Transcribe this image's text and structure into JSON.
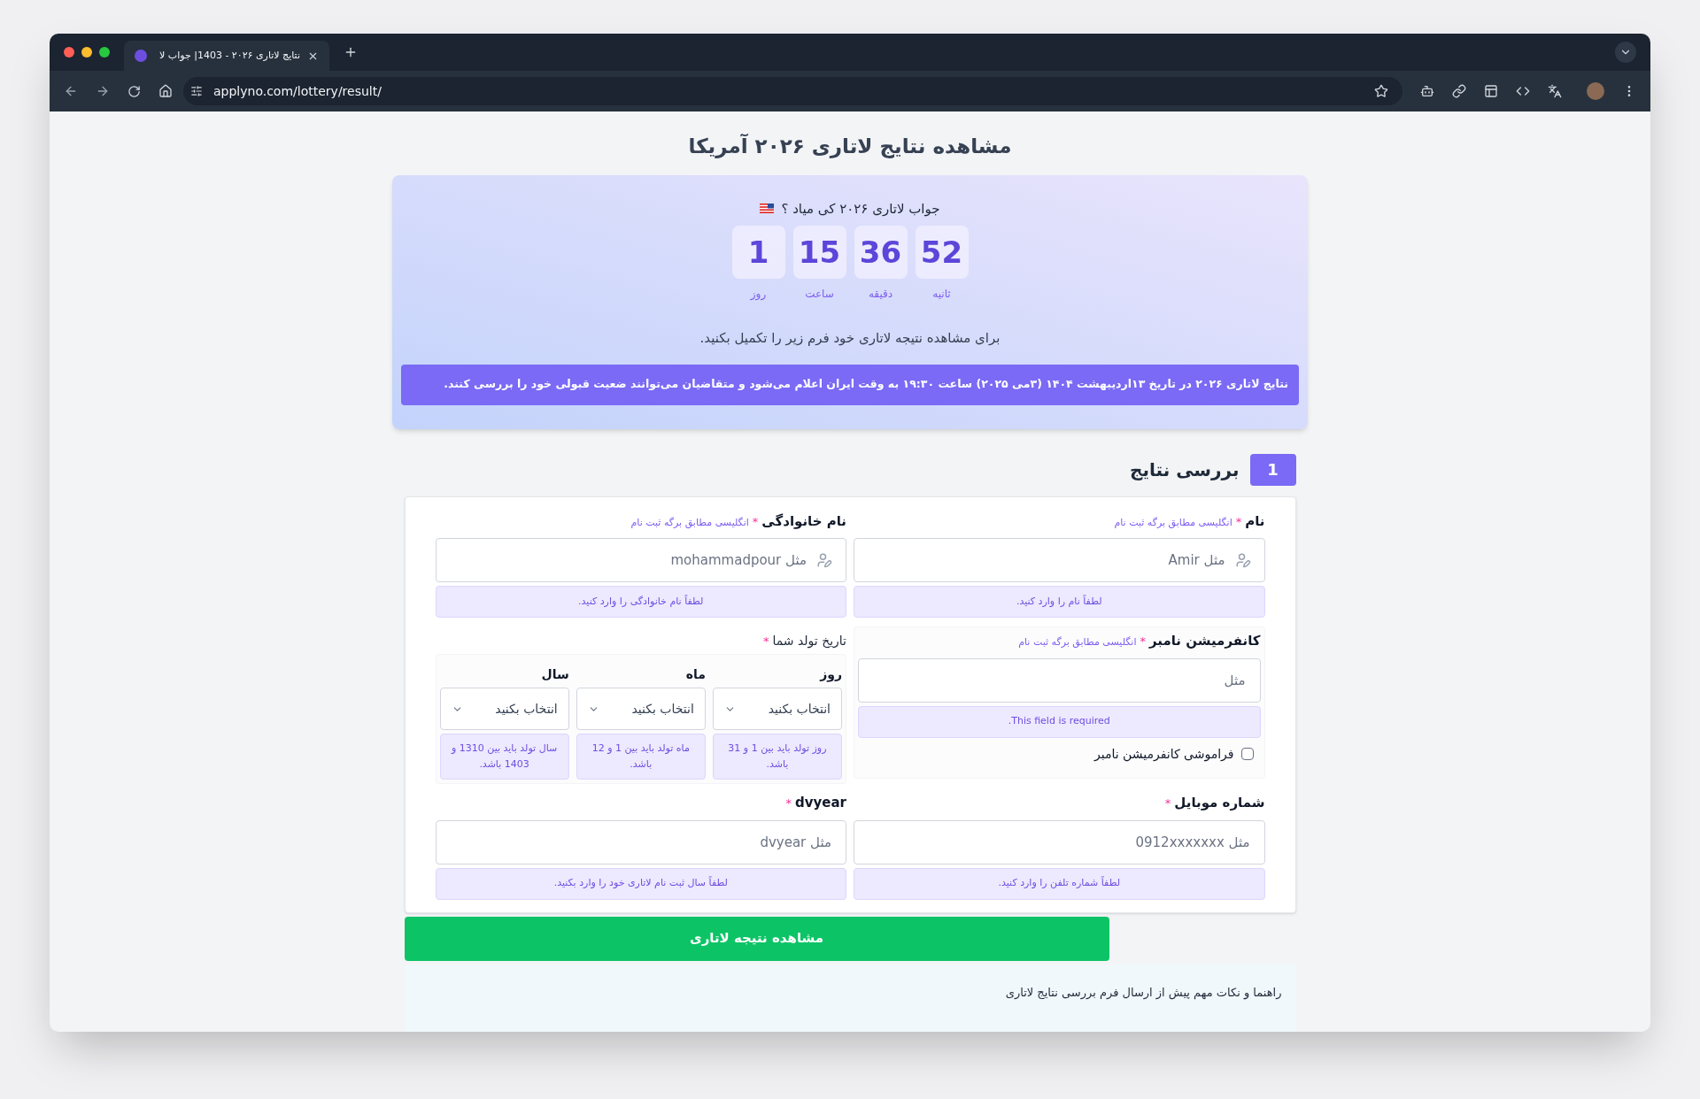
{
  "browser": {
    "tab_title": "نتایج لاتاری ۲۰۲۶ - 1403| جواب لا",
    "url": "applyno.com/lottery/result/"
  },
  "page_title": "مشاهده نتایج لاتاری ۲۰۲۶ آمریکا",
  "countdown": {
    "question": "جواب لاتاری ۲۰۲۶ کی میاد ؟",
    "units": [
      {
        "value": "52",
        "label": "ثانیه"
      },
      {
        "value": "36",
        "label": "دقیقه"
      },
      {
        "value": "15",
        "label": "ساعت"
      },
      {
        "value": "1",
        "label": "روز"
      }
    ],
    "instruction": "برای مشاهده نتیجه لاتاری خود فرم زیر را تکمیل بکنید.",
    "notice": "نتایج لاتاری ۲۰۲۶ در تاریخ ۱۳اردیبهشت ۱۴۰۴ (۳می ۲۰۲۵) ساعت ۱۹:۳۰ به وقت ایران اعلام می‌شود و متقاضیان می‌توانند ضعیت قبولی خود را بررسی کنند."
  },
  "section": {
    "number": "1",
    "title": "بررسی نتایج"
  },
  "fields": [
    {
      "kind": "person",
      "label": "نام",
      "required_mark": "*",
      "hint": "انگلیسی مطابق برگه ثبت نام",
      "placeholder": "مثل Amir",
      "error": "لطفاً نام را وارد کنید."
    },
    {
      "kind": "person",
      "label": "نام خانوادگی",
      "required_mark": "*",
      "hint": "انگلیسی مطابق برگه ثبت نام",
      "placeholder": "مثل mohammadpour",
      "error": "لطفاً نام خانوادگی را وارد کنید."
    },
    {
      "kind": "confirmation",
      "label": "کانفرمیشن نامبر",
      "required_mark": "*",
      "hint": "انگلیسی مطابق برگه ثبت نام",
      "placeholder": "مثل",
      "error": "This field is required.",
      "checkbox": {
        "label": "فراموشی کانفرمیشن نامبر",
        "checked": false
      }
    },
    {
      "kind": "date",
      "label": "تاریخ تولد شما",
      "required_mark": "*",
      "parts": [
        {
          "label": "روز",
          "placeholder": "انتخاب بکنید",
          "error": "روز تولد باید بین 1 و 31 باشد."
        },
        {
          "label": "ماه",
          "placeholder": "انتخاب بکنید",
          "error": "ماه تولد باید بین 1 و 12 باشد."
        },
        {
          "label": "سال",
          "placeholder": "انتخاب بکنید",
          "error": "سال تولد باید بین 1310 و 1403 باشد."
        }
      ]
    },
    {
      "kind": "plain",
      "label": "شماره موبایل",
      "required_mark": "*",
      "placeholder": "مثل 0912xxxxxxx",
      "error": "لطفاً شماره تلفن را وارد کنید."
    },
    {
      "kind": "plain",
      "label": "dvyear",
      "required_mark": "*",
      "placeholder": "مثل dvyear",
      "error": "لطفاً سال ثبت نام لاتاری خود را وارد بکنید."
    }
  ],
  "submit": "مشاهده نتیجه لاتاری",
  "guide": {
    "title": "راهنما و نکات مهم پیش از ارسال فرم بررسی نتایج لاتاری"
  }
}
